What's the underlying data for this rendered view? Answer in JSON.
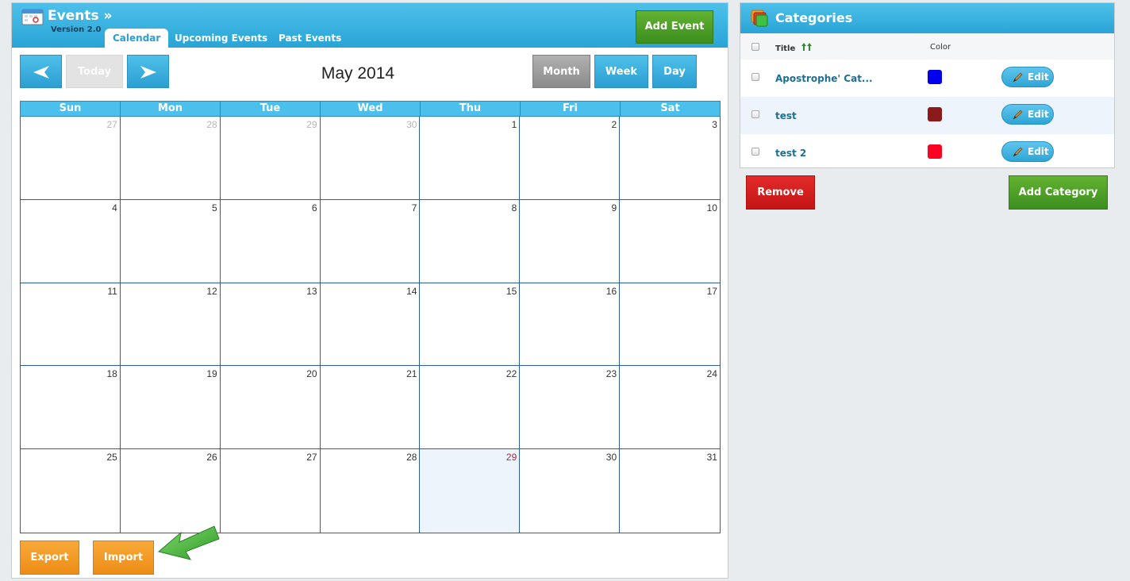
{
  "events": {
    "title": "Events »",
    "version": "Version 2.0",
    "tabs": [
      "Calendar",
      "Upcoming Events",
      "Past Events"
    ],
    "active_tab": "Calendar",
    "add_event_label": "Add Event",
    "today_label": "Today",
    "month_title": "May 2014",
    "views": [
      "Month",
      "Week",
      "Day"
    ],
    "active_view": "Month",
    "weekdays": [
      "Sun",
      "Mon",
      "Tue",
      "Wed",
      "Thu",
      "Fri",
      "Sat"
    ],
    "days": [
      {
        "n": "27",
        "other": true
      },
      {
        "n": "28",
        "other": true
      },
      {
        "n": "29",
        "other": true
      },
      {
        "n": "30",
        "other": true
      },
      {
        "n": "1"
      },
      {
        "n": "2"
      },
      {
        "n": "3"
      },
      {
        "n": "4"
      },
      {
        "n": "5"
      },
      {
        "n": "6"
      },
      {
        "n": "7"
      },
      {
        "n": "8"
      },
      {
        "n": "9"
      },
      {
        "n": "10"
      },
      {
        "n": "11"
      },
      {
        "n": "12"
      },
      {
        "n": "13"
      },
      {
        "n": "14"
      },
      {
        "n": "15"
      },
      {
        "n": "16"
      },
      {
        "n": "17"
      },
      {
        "n": "18"
      },
      {
        "n": "19"
      },
      {
        "n": "20"
      },
      {
        "n": "21"
      },
      {
        "n": "22"
      },
      {
        "n": "23"
      },
      {
        "n": "24"
      },
      {
        "n": "25"
      },
      {
        "n": "26"
      },
      {
        "n": "27"
      },
      {
        "n": "28"
      },
      {
        "n": "29",
        "today": true
      },
      {
        "n": "30"
      },
      {
        "n": "31"
      }
    ],
    "export_label": "Export",
    "import_label": "Import"
  },
  "categories": {
    "title": "Categories",
    "col_title": "Title",
    "col_color": "Color",
    "items": [
      {
        "name": "Apostrophe' Cat...",
        "color": "#0000ee",
        "edit": "Edit"
      },
      {
        "name": "test",
        "color": "#8b1a1a",
        "edit": "Edit"
      },
      {
        "name": "test 2",
        "color": "#ff0022",
        "edit": "Edit"
      }
    ],
    "remove_label": "Remove",
    "add_label": "Add Category"
  },
  "icons": {
    "events": "calendar-icon",
    "categories": "folders-icon",
    "prev": "arrow-left-icon",
    "next": "arrow-right-icon",
    "sort": "sort-arrows-icon",
    "edit": "pencil-icon",
    "hint": "green-arrow-icon"
  }
}
